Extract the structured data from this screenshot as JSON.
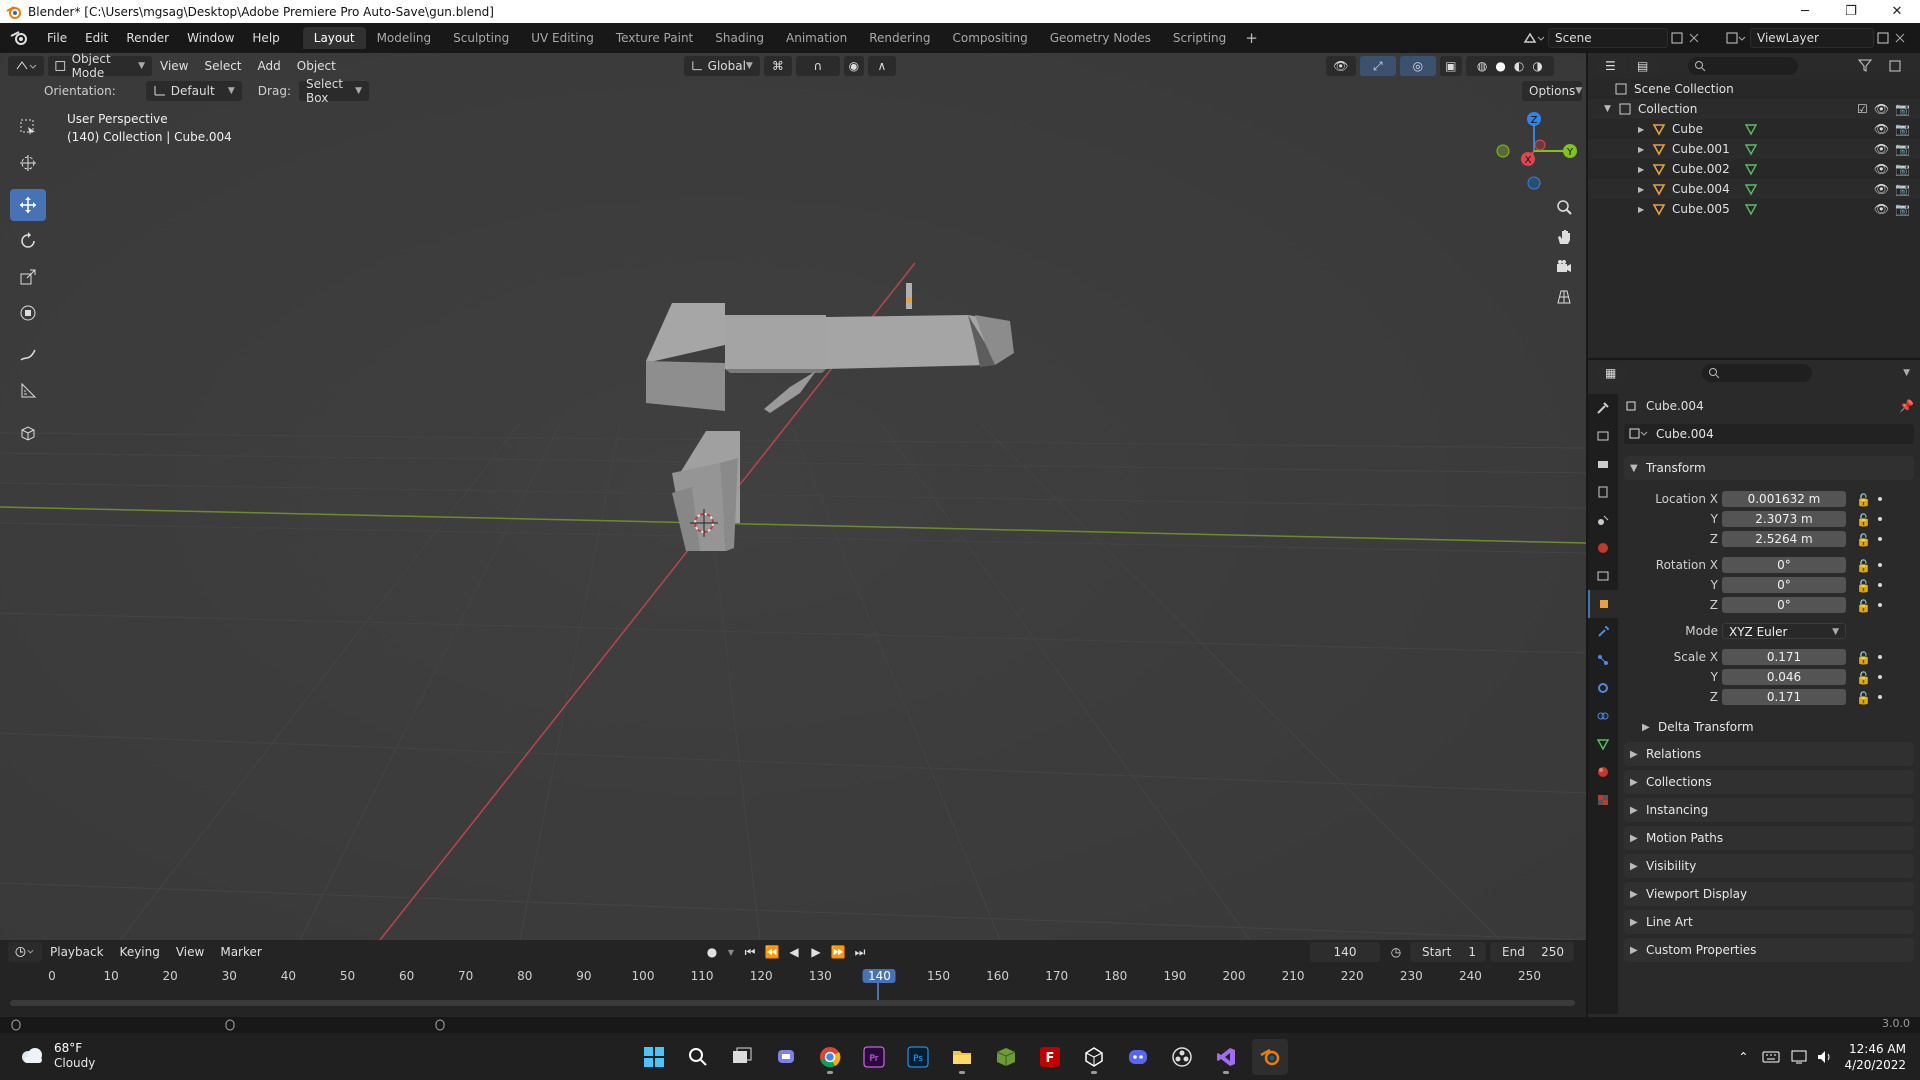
{
  "window": {
    "title": "Blender* [C:\\Users\\mgsag\\Desktop\\Adobe Premiere Pro Auto-Save\\gun.blend]",
    "minimize": "─",
    "maximize": "❐",
    "close": "✕"
  },
  "menubar": {
    "items": [
      "File",
      "Edit",
      "Render",
      "Window",
      "Help"
    ]
  },
  "workspaces": {
    "tabs": [
      "Layout",
      "Modeling",
      "Sculpting",
      "UV Editing",
      "Texture Paint",
      "Shading",
      "Animation",
      "Rendering",
      "Compositing",
      "Geometry Nodes",
      "Scripting"
    ],
    "active": "Layout",
    "add": "+"
  },
  "scene": {
    "name": "Scene"
  },
  "view_layer": {
    "name": "ViewLayer"
  },
  "viewport": {
    "mode": "Object Mode",
    "menus": [
      "View",
      "Select",
      "Add",
      "Object"
    ],
    "transform_orientation": "Global",
    "orientation_label": "Orientation:",
    "orientation_value": "Default",
    "drag_label": "Drag:",
    "drag_value": "Select Box",
    "options": "Options",
    "info_line1": "User Perspective",
    "info_line2": "(140) Collection | Cube.004",
    "gizmo_axes": {
      "x": "X",
      "y": "Y",
      "z": "Z"
    }
  },
  "timeline": {
    "menus": [
      "Playback",
      "Keying",
      "View",
      "Marker"
    ],
    "current_frame": "140",
    "start_label": "Start",
    "start": "1",
    "end_label": "End",
    "end": "250",
    "ticks": [
      "0",
      "10",
      "20",
      "30",
      "40",
      "50",
      "60",
      "70",
      "80",
      "90",
      "100",
      "110",
      "120",
      "130",
      "140",
      "150",
      "160",
      "170",
      "180",
      "190",
      "200",
      "210",
      "220",
      "230",
      "240",
      "250"
    ]
  },
  "outliner": {
    "scene_collection": "Scene Collection",
    "collection": "Collection",
    "objects": [
      "Cube",
      "Cube.001",
      "Cube.002",
      "Cube.004",
      "Cube.005"
    ]
  },
  "properties": {
    "object_name": "Cube.004",
    "object_field": "Cube.004",
    "transform_label": "Transform",
    "location_x_label": "Location X",
    "location_x": "0.001632 m",
    "location_y": "2.3073 m",
    "location_z": "2.5264 m",
    "rotation_x_label": "Rotation X",
    "rotation_x": "0°",
    "rotation_y": "0°",
    "rotation_z": "0°",
    "mode_label": "Mode",
    "mode_value": "XYZ Euler",
    "scale_x_label": "Scale X",
    "scale_x": "0.171",
    "scale_y": "0.046",
    "scale_z": "0.171",
    "y_label": "Y",
    "z_label": "Z",
    "delta_transform": "Delta Transform",
    "sections": [
      "Relations",
      "Collections",
      "Instancing",
      "Motion Paths",
      "Visibility",
      "Viewport Display",
      "Line Art",
      "Custom Properties"
    ]
  },
  "status": {
    "version": "3.0.0"
  },
  "taskbar": {
    "temperature": "68°F",
    "condition": "Cloudy",
    "time": "12:46 AM",
    "date": "4/20/2022"
  },
  "colors": {
    "accent": "#4772b3",
    "x_axis": "#e0454f",
    "y_axis": "#80c31b",
    "z_axis": "#2f86e8",
    "object_orange": "#e8a040"
  }
}
